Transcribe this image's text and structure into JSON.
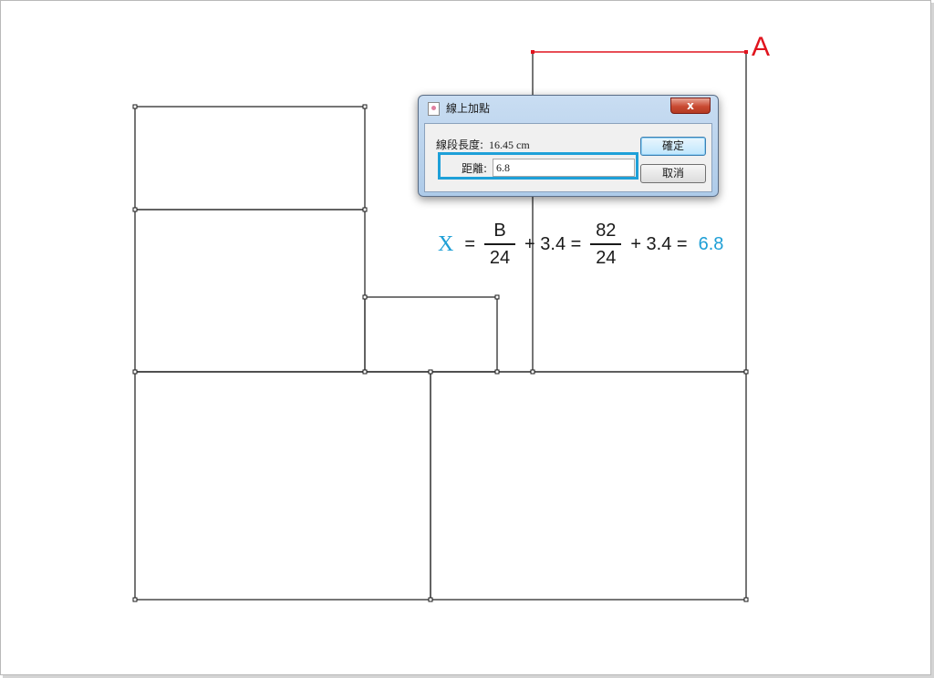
{
  "point_label": "A",
  "formula": {
    "variable": "X",
    "equals": "=",
    "frac1": {
      "numerator": "B",
      "denominator": "24"
    },
    "plus1": "+ 3.4 =",
    "frac2": {
      "numerator": "82",
      "denominator": "24"
    },
    "plus2": "+ 3.4 =",
    "result": "6.8"
  },
  "dialog": {
    "title": "線上加點",
    "close_label": "x",
    "length_label": "線段長度:",
    "length_value": "16.45 cm",
    "distance_label": "距離:",
    "distance_value": "6.8",
    "ok_label": "確定",
    "cancel_label": "取消"
  },
  "colors": {
    "accent_blue": "#1ea0d8",
    "point_red": "#e0141e"
  }
}
